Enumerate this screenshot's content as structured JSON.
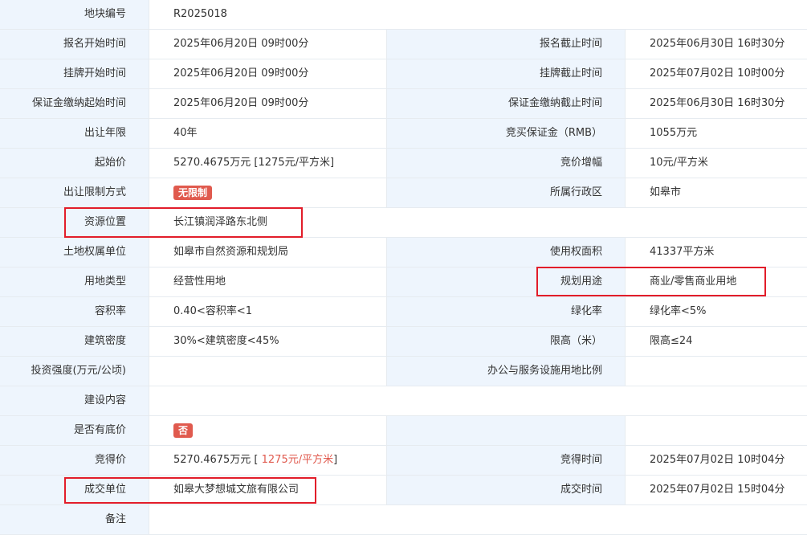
{
  "rows": [
    {
      "l1": "地块编号",
      "v1": "R2025018"
    },
    {
      "l1": "报名开始时间",
      "v1": "2025年06月20日 09时00分",
      "l2": "报名截止时间",
      "v2": "2025年06月30日 16时30分"
    },
    {
      "l1": "挂牌开始时间",
      "v1": "2025年06月20日 09时00分",
      "l2": "挂牌截止时间",
      "v2": "2025年07月02日 10时00分"
    },
    {
      "l1": "保证金缴纳起始时间",
      "v1": "2025年06月20日 09时00分",
      "l2": "保证金缴纳截止时间",
      "v2": "2025年06月30日 16时30分"
    },
    {
      "l1": "出让年限",
      "v1": "40年",
      "l2": "竞买保证金（RMB）",
      "v2": "1055万元"
    },
    {
      "l1": "起始价",
      "v1": "5270.4675万元 [1275元/平方米]",
      "l2": "竞价增幅",
      "v2": "10元/平方米"
    },
    {
      "l1": "出让限制方式",
      "v1": "无限制",
      "l2": "所属行政区",
      "v2": "如皋市"
    },
    {
      "l1": "资源位置",
      "v1": "长江镇润泽路东北侧"
    },
    {
      "l1": "土地权属单位",
      "v1": "如皋市自然资源和规划局",
      "l2": "使用权面积",
      "v2": "41337平方米"
    },
    {
      "l1": "用地类型",
      "v1": "经营性用地",
      "l2": "规划用途",
      "v2": "商业/零售商业用地"
    },
    {
      "l1": "容积率",
      "v1": "0.40<容积率<1",
      "l2": "绿化率",
      "v2": "绿化率<5%"
    },
    {
      "l1": "建筑密度",
      "v1": "30%<建筑密度<45%",
      "l2": "限高（米）",
      "v2": "限高≤24"
    },
    {
      "l1": "投资强度(万元/公顷)",
      "v1": "",
      "l2": "办公与服务设施用地比例",
      "v2": ""
    },
    {
      "l1": "建设内容",
      "v1": ""
    },
    {
      "l1": "是否有底价",
      "v1": "否",
      "l2": "",
      "v2": ""
    },
    {
      "l1": "竞得价",
      "v1_prefix": "5270.4675万元 [ ",
      "v1_red": "1275元/平方米",
      "v1_suffix": "]",
      "l2": "竞得时间",
      "v2": "2025年07月02日 10时04分"
    },
    {
      "l1": "成交单位",
      "v1": "如皋大梦想城文旅有限公司",
      "l2": "成交时间",
      "v2": "2025年07月02日 15时04分"
    },
    {
      "l1": "备注",
      "v1": ""
    }
  ],
  "colors": {
    "label_bg": "#eef5fd",
    "border": "#e6ebf0",
    "badge": "#e05a4e",
    "highlight": "#e21d2a"
  }
}
